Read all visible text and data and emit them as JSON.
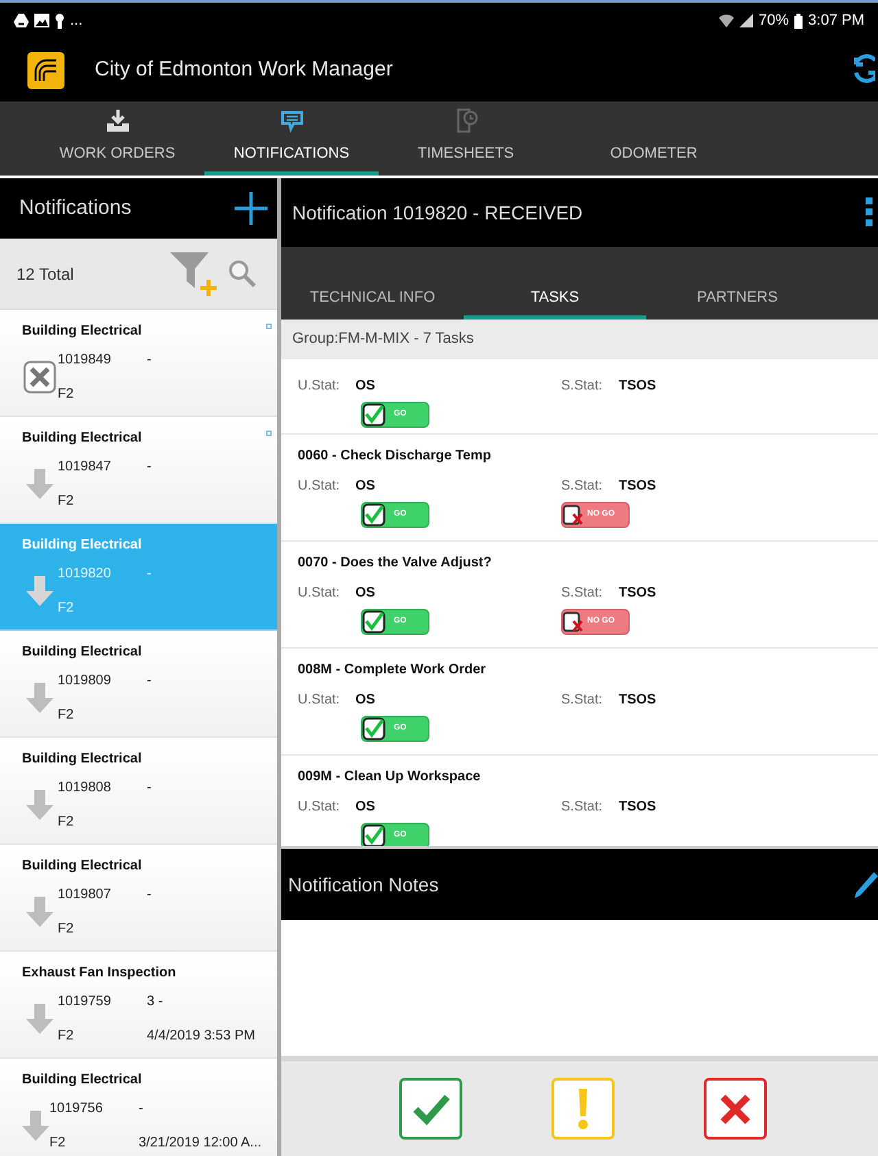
{
  "status_bar": {
    "more": "...",
    "battery": "70%",
    "time": "3:07 PM"
  },
  "app_bar": {
    "title": "City of Edmonton Work Manager"
  },
  "main_tabs": [
    {
      "label": "WORK ORDERS",
      "kind": "download",
      "selected": false
    },
    {
      "label": "NOTIFICATIONS",
      "kind": "message",
      "selected": true
    },
    {
      "label": "TIMESHEETS",
      "kind": "clock",
      "selected": false
    },
    {
      "label": "ODOMETER",
      "kind": "none",
      "selected": false
    }
  ],
  "sidebar": {
    "title": "Notifications",
    "total": "12 Total",
    "items": [
      {
        "title": "Building Electrical",
        "id": "1019849",
        "code": "-",
        "priority": "F2",
        "kind": "cancelled",
        "unread": true,
        "selected": false
      },
      {
        "title": "Building Electrical",
        "id": "1019847",
        "code": "-",
        "priority": "F2",
        "kind": "download",
        "unread": true,
        "selected": false
      },
      {
        "title": "Building Electrical",
        "id": "1019820",
        "code": "-",
        "priority": "F2",
        "kind": "download",
        "unread": false,
        "selected": true
      },
      {
        "title": "Building Electrical",
        "id": "1019809",
        "code": "-",
        "priority": "F2",
        "kind": "download",
        "unread": false,
        "selected": false
      },
      {
        "title": "Building Electrical",
        "id": "1019808",
        "code": "-",
        "priority": "F2",
        "kind": "download",
        "unread": false,
        "selected": false
      },
      {
        "title": "Building Electrical",
        "id": "1019807",
        "code": "-",
        "priority": "F2",
        "kind": "download",
        "unread": false,
        "selected": false
      },
      {
        "title": "Exhaust Fan Inspection",
        "id": "1019759",
        "code": "3 -",
        "priority": "F2",
        "date": "4/4/2019 3:53 PM",
        "kind": "download",
        "unread": false,
        "selected": false
      },
      {
        "title": "Building Electrical",
        "id": "1019756",
        "code": "-",
        "priority": "F2",
        "date": "3/21/2019 12:00 A...",
        "kind": "download",
        "unread": false,
        "selected": false
      }
    ]
  },
  "detail": {
    "title": "Notification 1019820 - RECEIVED",
    "tabs": [
      {
        "label": "TECHNICAL INFO",
        "selected": false
      },
      {
        "label": "TASKS",
        "selected": true
      },
      {
        "label": "PARTNERS",
        "selected": false
      }
    ],
    "group": "Group:FM-M-MIX - 7 Tasks",
    "tasks": [
      {
        "u_stat_label": "U.Stat:",
        "u_stat": "OS",
        "s_stat_label": "S.Stat:",
        "s_stat": "TSOS",
        "go": "GO"
      },
      {
        "title": "0060 - Check Discharge Temp",
        "u_stat_label": "U.Stat:",
        "u_stat": "OS",
        "s_stat_label": "S.Stat:",
        "s_stat": "TSOS",
        "go": "GO",
        "no_go": "NO GO"
      },
      {
        "title": "0070 - Does the Valve Adjust?",
        "u_stat_label": "U.Stat:",
        "u_stat": "OS",
        "s_stat_label": "S.Stat:",
        "s_stat": "TSOS",
        "go": "GO",
        "no_go": "NO GO"
      },
      {
        "title": "008M - Complete Work Order",
        "u_stat_label": "U.Stat:",
        "u_stat": "OS",
        "s_stat_label": "S.Stat:",
        "s_stat": "TSOS",
        "go": "GO"
      },
      {
        "title": "009M - Clean Up Workspace",
        "u_stat_label": "U.Stat:",
        "u_stat": "OS",
        "s_stat_label": "S.Stat:",
        "s_stat": "TSOS",
        "go": "GO"
      }
    ],
    "notes_title": "Notification Notes"
  }
}
